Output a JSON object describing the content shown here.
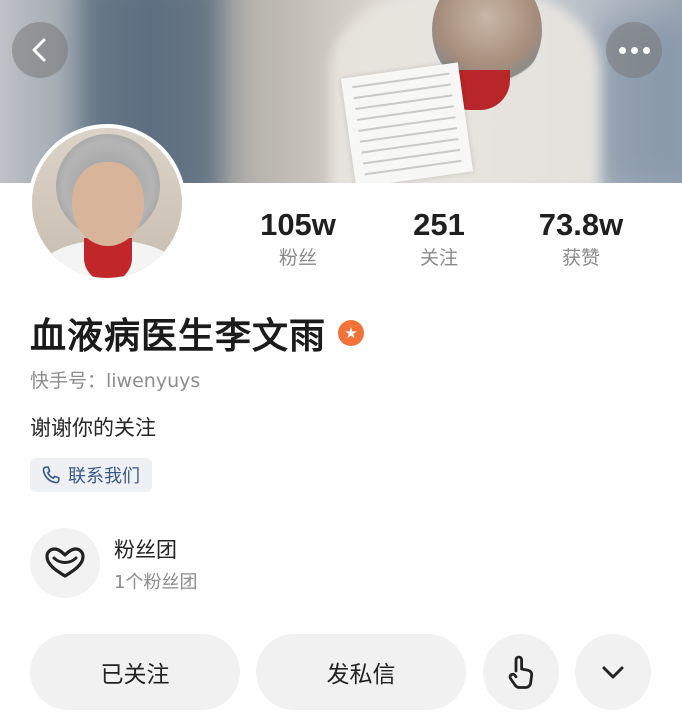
{
  "header": {
    "back_icon": "chevron-left-icon",
    "more_icon": "more-dots-icon"
  },
  "profile": {
    "name": "血液病医生李文雨",
    "verified_badge_icon": "star-badge-icon",
    "verified_badge_color": "#f2733a",
    "kuaishou_id": "快手号：liwenyuys",
    "bio": "谢谢你的关注",
    "contact_label": "联系我们",
    "contact_icon": "phone-icon"
  },
  "stats": [
    {
      "value": "105w",
      "label": "粉丝"
    },
    {
      "value": "251",
      "label": "关注"
    },
    {
      "value": "73.8w",
      "label": "获赞"
    }
  ],
  "fan_club": {
    "title": "粉丝团",
    "subtitle": "1个粉丝团",
    "icon": "heart-outline-icon"
  },
  "actions": {
    "follow_label": "已关注",
    "message_label": "发私信",
    "tap_icon": "hand-tap-icon",
    "expand_icon": "chevron-down-icon"
  }
}
